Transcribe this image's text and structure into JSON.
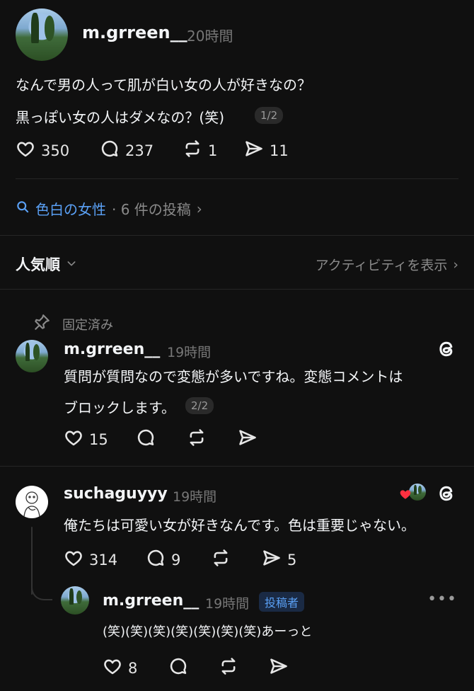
{
  "post": {
    "username": "m.grreen__",
    "time": "20時間",
    "line1": "なんで男の人って肌が白い女の人が好きなの？",
    "line2": "黒っぽい女の人はダメなの？(笑)",
    "page": "1/2",
    "likes": "350",
    "comments": "237",
    "reposts": "1",
    "shares": "11"
  },
  "topic": {
    "tag": "色白の女性",
    "count": "· 6 件の投稿"
  },
  "sort": {
    "label": "人気順",
    "activity": "アクティビティを表示"
  },
  "pinned": {
    "label": "固定済み",
    "username": "m.grreen__",
    "time": "19時間",
    "line1": "質問が質問なので変態が多いですね。変態コメントは",
    "line2": "ブロックします。",
    "page": "2/2",
    "likes": "15"
  },
  "reply1": {
    "username": "suchaguyyy",
    "time": "19時間",
    "text": "俺たちは可愛い女が好きなんです。色は重要じゃない。",
    "likes": "314",
    "comments": "9",
    "shares": "5"
  },
  "reply2": {
    "username": "m.grreen__",
    "time": "19時間",
    "badge": "投稿者",
    "text": "(笑)(笑)(笑)(笑)(笑)(笑)(笑)あーっと",
    "likes": "8"
  },
  "colors": {
    "background": "#101010",
    "accent_blue": "#5aa0f5",
    "heart_red": "#ff3040"
  }
}
